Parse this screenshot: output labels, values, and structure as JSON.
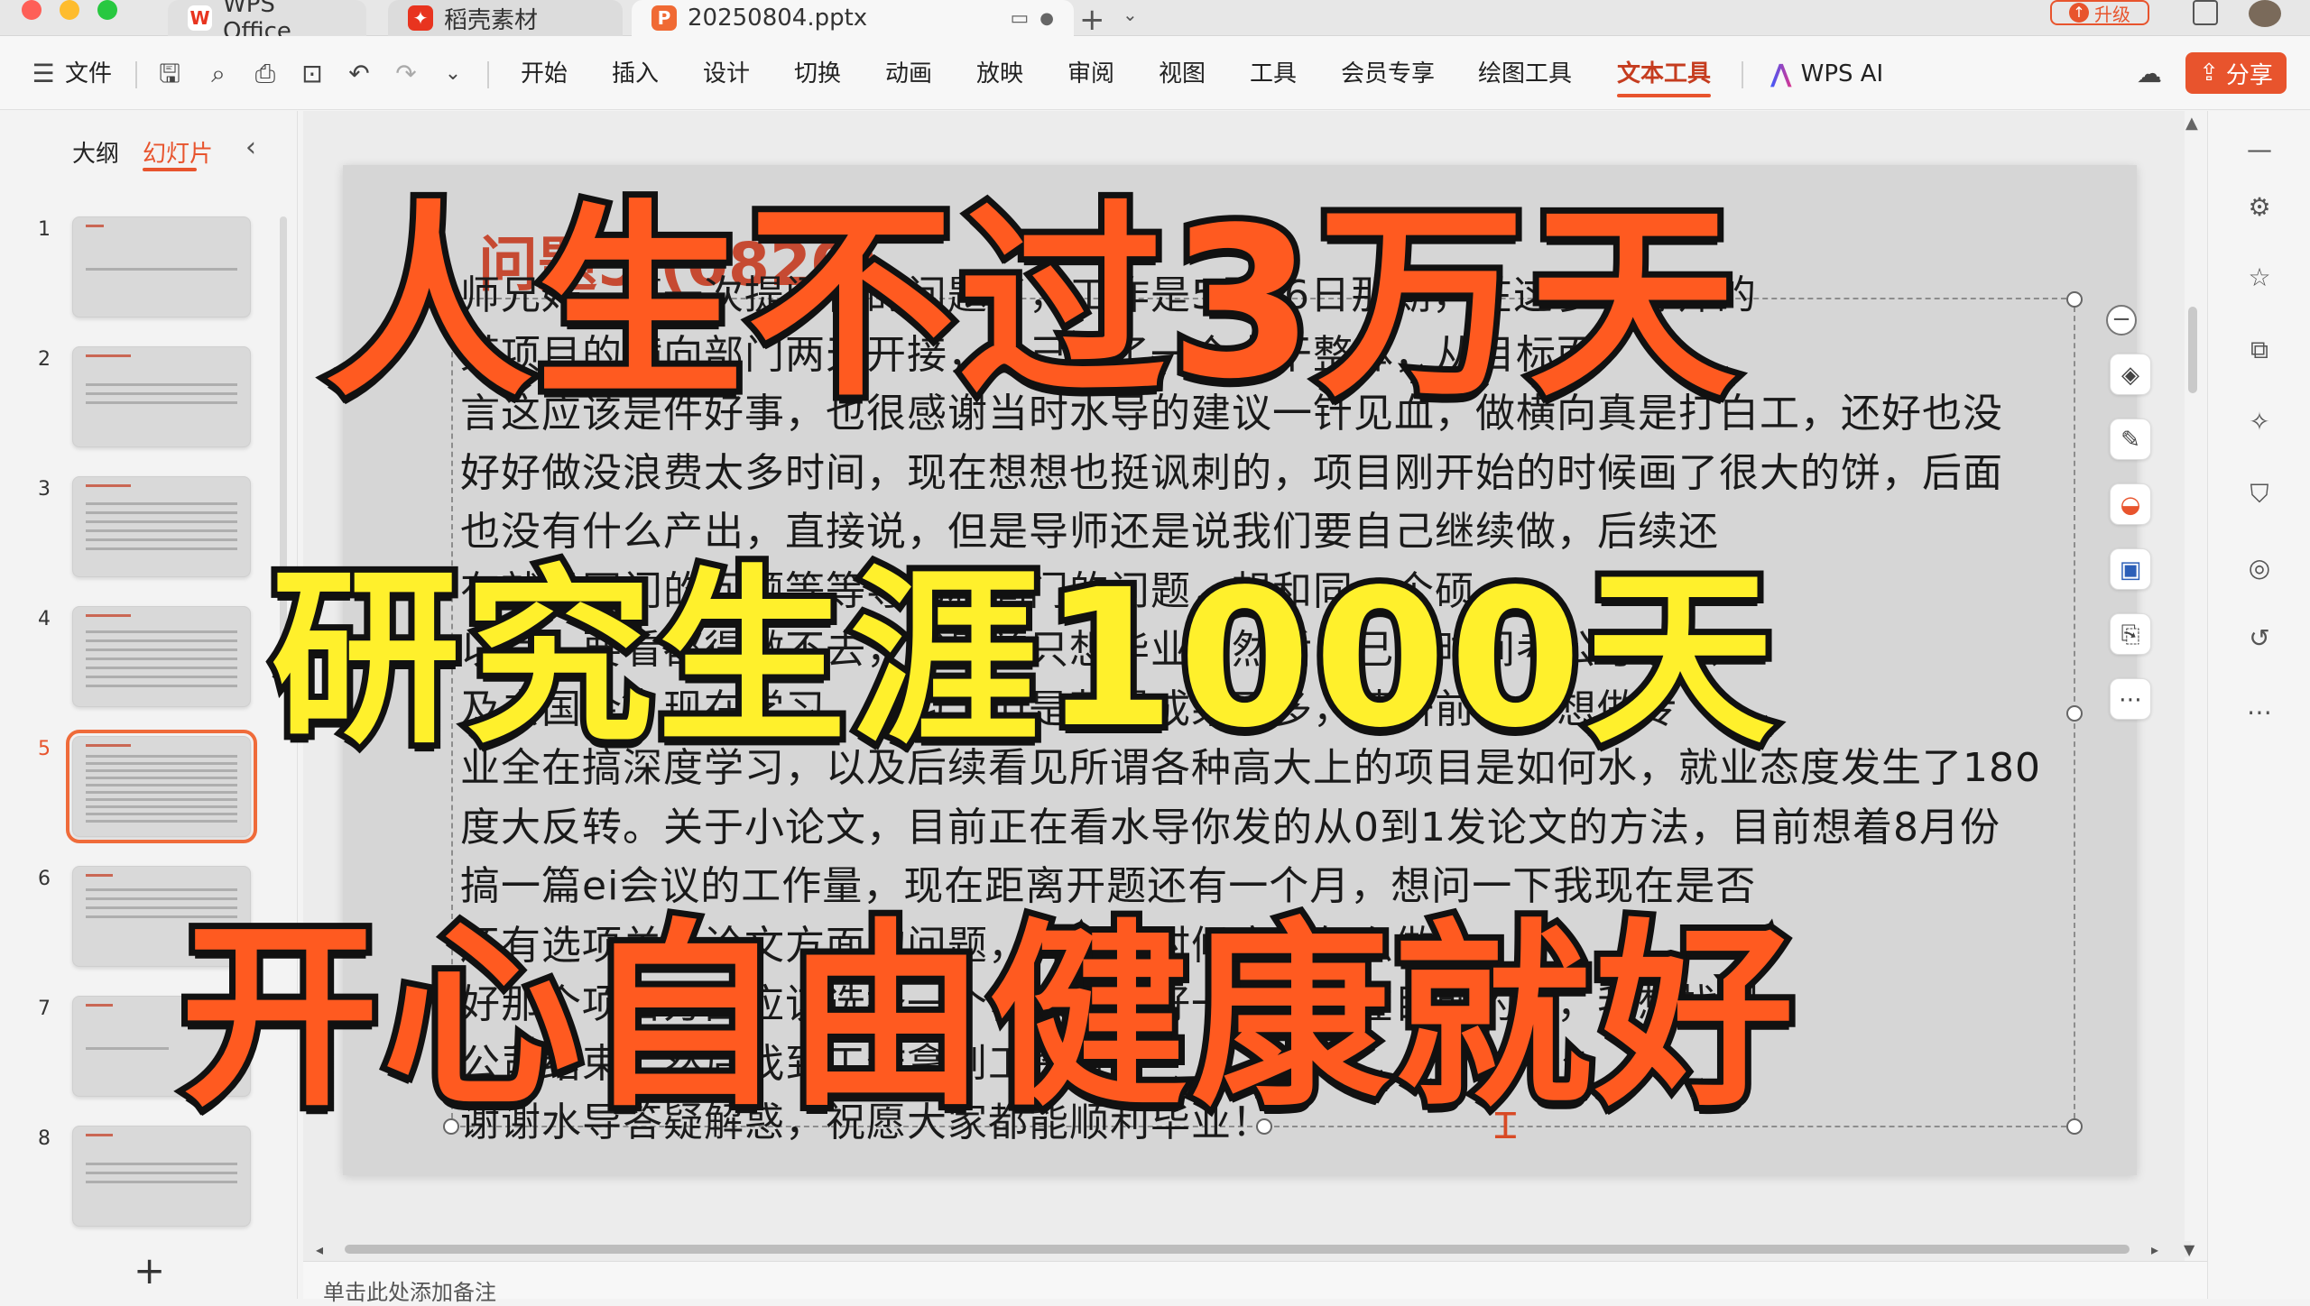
{
  "titlebar": {
    "tabs": [
      {
        "label": "WPS Office",
        "icon": "wps-logo-icon",
        "color": "#e8341f"
      },
      {
        "label": "稻壳素材",
        "icon": "docer-icon",
        "color": "#e8341f"
      },
      {
        "label": "20250804.pptx",
        "icon": "pptx-file-icon",
        "color": "#f06a34"
      }
    ],
    "upgrade_label": "升级"
  },
  "ribbon": {
    "file_label": "文件",
    "tabs": [
      "开始",
      "插入",
      "设计",
      "切换",
      "动画",
      "放映",
      "审阅",
      "视图",
      "工具",
      "会员专享",
      "绘图工具",
      "文本工具"
    ],
    "active_tab": "文本工具",
    "wps_ai_label": "WPS AI",
    "share_label": "分享",
    "accent_color": "#e8542d"
  },
  "left_panel": {
    "outline_label": "大纲",
    "slides_label": "幻灯片",
    "thumbnails": [
      {
        "number": "1"
      },
      {
        "number": "2"
      },
      {
        "number": "3"
      },
      {
        "number": "4"
      },
      {
        "number": "5",
        "selected": true
      },
      {
        "number": "6"
      },
      {
        "number": "7"
      },
      {
        "number": "8"
      }
    ],
    "add_slide": "+"
  },
  "slide": {
    "title": "问题5 (0820)",
    "body_lines": [
      "师兄好，第一次提问你的问题了，工作是5月26日那期，在这参与导师的",
      "某项目的横向部门两天开接，自己去了一个人干整体，从目标而",
      "言这应该是件好事，也很感谢当时水导的建议一针见血，做横向真是打白工，还好也没",
      "好好做没浪费太多时间，现在想想也挺讽刺的，项目刚开始的时候画了很大的饼，后面",
      "也没有什么产出，直接说，但是导师还是说我们要自己继续做，后续还",
      "有就是同门的问题等等导师和同门的问题，想和同一个硕",
      "以后，要看都得做不去，我目前只想毕业，然后自己留时间考公考编以",
      "及去国企，现在学习，学习，但是获得成果不多，读研前也曾想做专",
      "业全在搞深度学习，以及后续看见所谓各种高大上的项目是如何水，就业态度发生了180",
      "度大反转。关于小论文，目前正在看水导你发的从0到1发论文的方法，目前想着8月份",
      "搞一篇ei会议的工作量，现在距离开题还有一个月，想问一下我现在是否",
      "还有选项关于论文方面的问题，开题的时候应该怎么做",
      "好那个项目方面应该选择一个什么方向好一些，现在目前的话，我想找到",
      "公司结束，然后找到工作拿到工资就好",
      "谢谢水导答疑解惑，祝愿大家都能顺利毕业！"
    ]
  },
  "overlay": {
    "line1": "人生不过3万天",
    "line2": "研究生涯1000天",
    "line3": "开心自由健康就好",
    "orange": "#ff5a20",
    "yellow": "#fff02c"
  },
  "notes_placeholder": "单击此处添加备注"
}
